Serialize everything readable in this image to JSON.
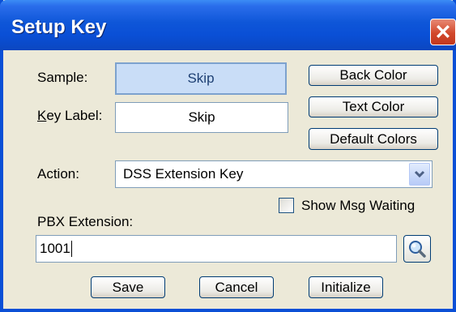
{
  "window": {
    "title": "Setup Key",
    "close_glyph": "✕"
  },
  "labels": {
    "sample": "Sample:",
    "key_label_first": "K",
    "key_label_rest": "ey Label:",
    "action": "Action:",
    "pbx_extension": "PBX Extension:",
    "show_msg_waiting": "Show Msg Waiting"
  },
  "sample": {
    "text": "Skip"
  },
  "key_label": {
    "value": "Skip"
  },
  "buttons": {
    "back_color": "Back Color",
    "text_color": "Text Color",
    "default_colors": "Default Colors",
    "save": "Save",
    "cancel": "Cancel",
    "initialize": "Initialize"
  },
  "action": {
    "selected": "DSS Extension Key"
  },
  "show_msg_waiting": {
    "checked": false
  },
  "pbx_extension": {
    "value": "1001"
  },
  "icons": {
    "dropdown": "chevron-down-icon",
    "search": "magnifier-icon",
    "close": "close-icon"
  },
  "colors": {
    "title_bar": "#0A4FD6",
    "dialog_bg": "#ECE9D8",
    "close_button": "#D2482C",
    "sample_bg": "#C9DDF7",
    "sample_text": "#1D3F73"
  }
}
